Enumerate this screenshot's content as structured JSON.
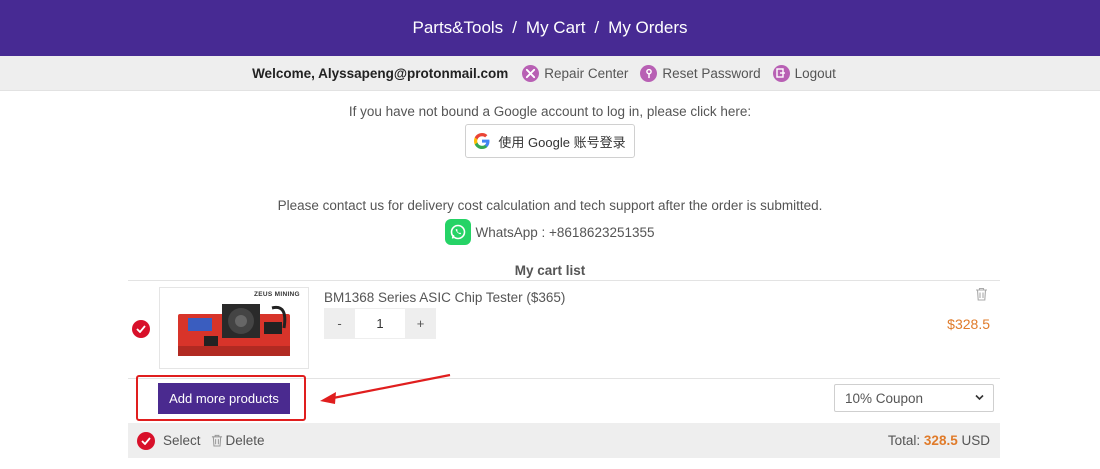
{
  "nav": {
    "parts_tools": "Parts&Tools",
    "my_cart": "My Cart",
    "my_orders": "My Orders",
    "separator": "/"
  },
  "userbar": {
    "welcome": "Welcome, Alyssapeng@protonmail.com",
    "repair_center": "Repair Center",
    "reset_password": "Reset Password",
    "logout": "Logout"
  },
  "google": {
    "hint": "If you have not bound a Google account to log in, please click here:",
    "button_label": "使用 Google 账号登录"
  },
  "contact": {
    "note": "Please contact us for delivery cost calculation and tech support after the order is submitted.",
    "whatsapp": "WhatsApp : +8618623251355"
  },
  "cart": {
    "title": "My cart list",
    "items": [
      {
        "name": "BM1368 Series ASIC Chip Tester ($365)",
        "brand": "ZEUS MINING",
        "quantity": "1",
        "minus": "-",
        "plus": "+",
        "price": "$328.5",
        "selected": true
      }
    ],
    "add_more_label": "Add more products",
    "coupon": {
      "selected": "10% Coupon"
    },
    "footer": {
      "select_label": "Select",
      "delete_label": "Delete",
      "total_label": "Total:",
      "total_value": "328.5",
      "currency": "USD"
    }
  },
  "colors": {
    "brand": "#472a93",
    "button": "#4a2a8f",
    "price": "#e07b2a",
    "check": "#d8102a",
    "highlight": "#e01e1e"
  }
}
